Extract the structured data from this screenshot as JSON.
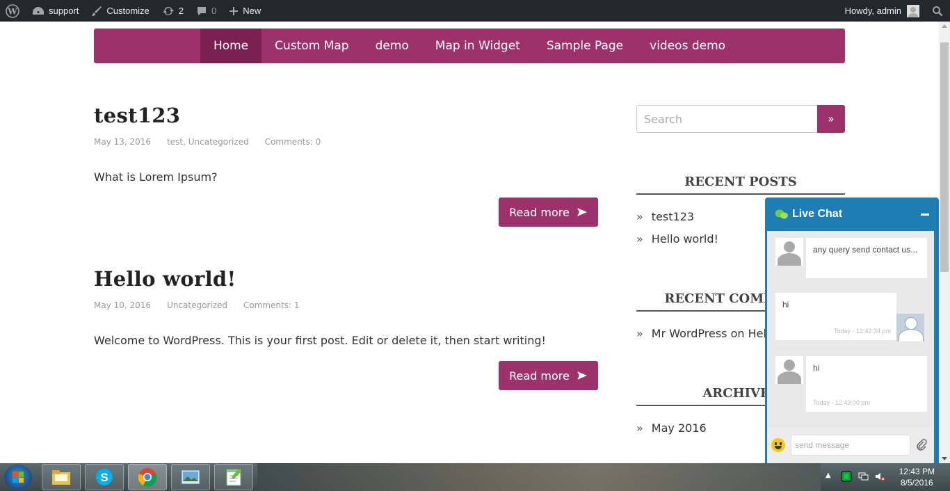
{
  "adminbar": {
    "site_name": "support",
    "customize": "Customize",
    "updates_count": "2",
    "comments_count": "0",
    "new_label": "New",
    "howdy": "Howdy, admin"
  },
  "nav": {
    "items": [
      "Home",
      "Custom Map",
      "demo",
      "Map in Widget",
      "Sample Page",
      "videos demo"
    ]
  },
  "posts": [
    {
      "title": "test123",
      "date": "May 13, 2016",
      "categories": "test, Uncategorized",
      "comments": "Comments: 0",
      "excerpt": "What is Lorem Ipsum?",
      "read_more": "Read more"
    },
    {
      "title": "Hello world!",
      "date": "May 10, 2016",
      "categories": "Uncategorized",
      "comments": "Comments: 1",
      "excerpt": "Welcome to WordPress. This is your first post. Edit or delete it, then start writing!",
      "read_more": "Read more"
    }
  ],
  "sidebar": {
    "search_placeholder": "Search",
    "search_button": "»",
    "recent_posts_title": "RECENT POSTS",
    "recent_posts": [
      "test123",
      "Hello world!"
    ],
    "recent_comments_title": "RECENT COMMENTS",
    "recent_comments": [
      "Mr WordPress on Hello world!"
    ],
    "archives_title": "ARCHIVES",
    "archives": [
      "May 2016"
    ],
    "bullet": "»"
  },
  "livechat": {
    "title": "Live Chat",
    "messages": [
      {
        "from": "visitor",
        "text": "any query send contact us...",
        "time": ""
      },
      {
        "from": "agent",
        "text": "hi",
        "time": "Today - 12:42:34 pm"
      },
      {
        "from": "visitor",
        "text": "hi",
        "time": "Today - 12:43:00 pm"
      }
    ],
    "input_placeholder": "send message"
  },
  "taskbar": {
    "time": "12:43 PM",
    "date": "8/5/2016"
  },
  "colors": {
    "brand": "#9c326b",
    "brand_dark": "#7a2151",
    "adminbar": "#23282d",
    "chat": "#1e7db3"
  }
}
